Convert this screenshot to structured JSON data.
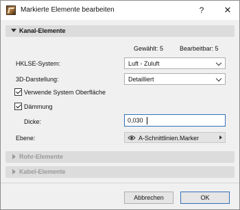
{
  "window": {
    "title": "Markierte Elemente bearbeiten",
    "help_label": "?",
    "close_label": "✕"
  },
  "sections": {
    "kanal": {
      "label": "Kanal-Elemente",
      "expanded": true
    },
    "rohr": {
      "label": "Rohr-Elemente",
      "expanded": false
    },
    "kabel": {
      "label": "Kabel-Elemente",
      "expanded": false
    }
  },
  "counts": {
    "gewaehlt": "Gewählt: 5",
    "bearbeitbar": "Bearbeitbar: 5"
  },
  "fields": {
    "hklse": {
      "label": "HKLSE-System:",
      "value": "Luft - Zuluft"
    },
    "darstellung": {
      "label": "3D-Darstellung:",
      "value": "Detailliert"
    },
    "system_oberflaeche": {
      "label": "Verwende System Oberfläche",
      "checked": true
    },
    "daemmung": {
      "label": "Dämmung",
      "checked": true
    },
    "dicke": {
      "label": "Dicke:",
      "value": "0,030"
    },
    "ebene": {
      "label": "Ebene:",
      "value": "A-Schnittlinien.Marker"
    }
  },
  "buttons": {
    "cancel": "Abbrechen",
    "ok": "OK"
  },
  "colors": {
    "focus_border": "#2f6fb8",
    "section_bg": "#dcdcdc",
    "dialog_bg": "#f0f0f0"
  }
}
